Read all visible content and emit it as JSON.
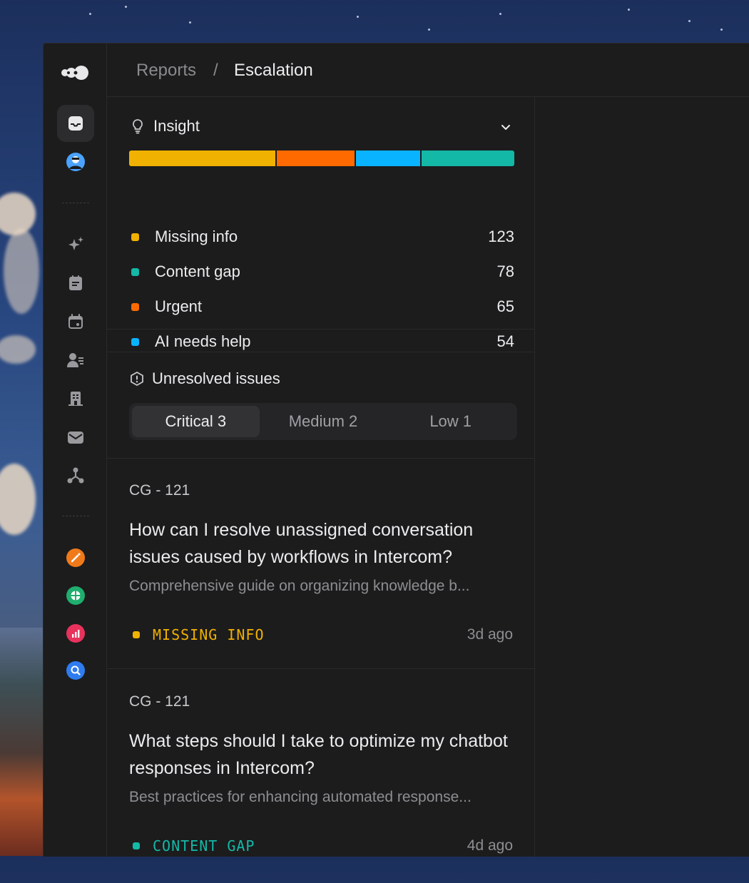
{
  "breadcrumb": {
    "parent": "Reports",
    "separator": "/",
    "current": "Escalation"
  },
  "sidebar": {
    "icons": [
      "inbox-icon",
      "avatar",
      "sparkles-icon",
      "notebook-icon",
      "calendar-icon",
      "contacts-icon",
      "building-icon",
      "mail-icon",
      "workflow-icon"
    ],
    "apps": [
      {
        "name": "wand-app-icon",
        "color": "#f07a1a"
      },
      {
        "name": "chart-app-icon",
        "color": "#1fae6e"
      },
      {
        "name": "stats-app-icon",
        "color": "#e8325c"
      },
      {
        "name": "search-app-icon",
        "color": "#2f7cf0"
      }
    ]
  },
  "insight": {
    "title": "Insight",
    "items": [
      {
        "label": "Missing info",
        "value": "123",
        "color": "#f0b100"
      },
      {
        "label": "Content gap",
        "value": "78",
        "color": "#14b8a6"
      },
      {
        "label": "Urgent",
        "value": "65",
        "color": "#ff6a00"
      },
      {
        "label": "AI needs help",
        "value": "54",
        "color": "#0ab3ff"
      }
    ],
    "bar": [
      {
        "value": 123,
        "color": "#f0b100"
      },
      {
        "value": 65,
        "color": "#ff6a00"
      },
      {
        "value": 54,
        "color": "#0ab3ff"
      },
      {
        "value": 78,
        "color": "#14b8a6"
      }
    ]
  },
  "issues": {
    "title": "Unresolved issues",
    "tabs": [
      {
        "label": "Critical 3",
        "selected": true
      },
      {
        "label": "Medium 2",
        "selected": false
      },
      {
        "label": "Low 1",
        "selected": false
      }
    ]
  },
  "cards": [
    {
      "id": "CG - 121",
      "title": "How can I resolve unassigned conversation issues caused by workflows in Intercom?",
      "desc": "Comprehensive guide on organizing knowledge b...",
      "tag": "MISSING INFO",
      "tag_color": "#f0b100",
      "age": "3d ago"
    },
    {
      "id": "CG - 121",
      "title": "What steps should I take to optimize my chatbot responses in Intercom?",
      "desc": "Best practices for enhancing automated response...",
      "tag": "CONTENT GAP",
      "tag_color": "#14b8a6",
      "age": "4d ago"
    }
  ]
}
